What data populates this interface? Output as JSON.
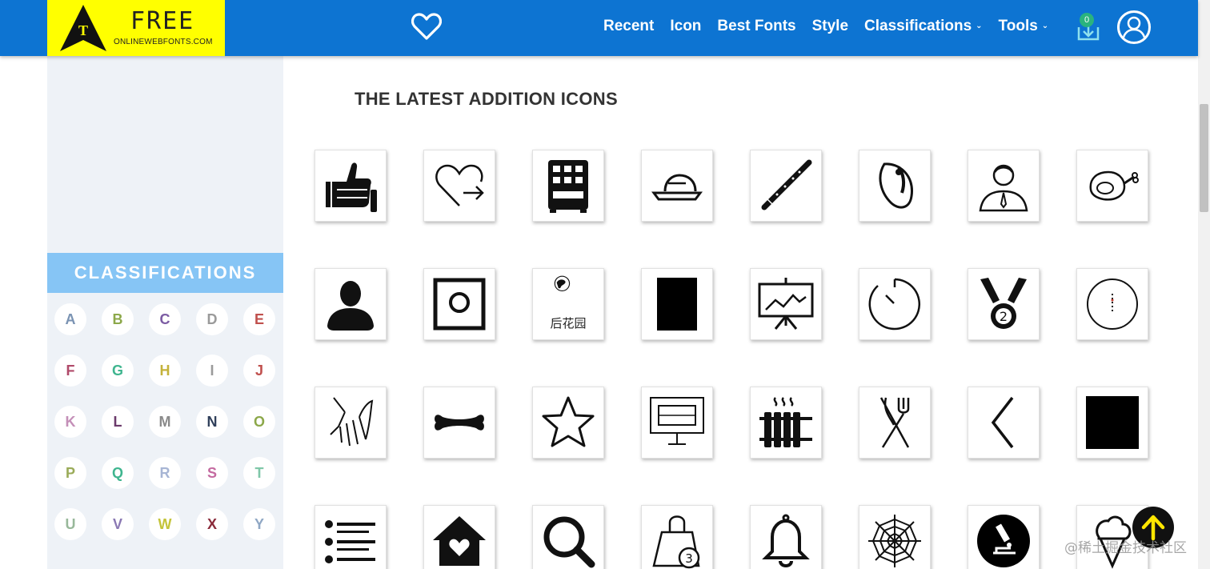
{
  "header": {
    "logo": {
      "free_text": "FREE",
      "site_text": "ONLINEWEBFONTS.COM",
      "mark_letter": "T"
    },
    "favorites_icon": "heart-icon",
    "nav": [
      {
        "label": "Recent",
        "dropdown": false
      },
      {
        "label": "Icon",
        "dropdown": false
      },
      {
        "label": "Best Fonts",
        "dropdown": false
      },
      {
        "label": "Style",
        "dropdown": false
      },
      {
        "label": "Classifications",
        "dropdown": true
      },
      {
        "label": "Tools",
        "dropdown": true
      }
    ],
    "cart": {
      "count": "0",
      "icon": "download-tray-icon"
    },
    "user_icon": "user-avatar-icon"
  },
  "sidebar": {
    "heading": "CLASSIFICATIONS",
    "letters": [
      {
        "label": "A",
        "color": "#7a93b3"
      },
      {
        "label": "B",
        "color": "#8ca84a"
      },
      {
        "label": "C",
        "color": "#7b5ba3"
      },
      {
        "label": "D",
        "color": "#9a9a9a"
      },
      {
        "label": "E",
        "color": "#c0504d"
      },
      {
        "label": "F",
        "color": "#b04a6a"
      },
      {
        "label": "G",
        "color": "#3fb58f"
      },
      {
        "label": "H",
        "color": "#c4b23a"
      },
      {
        "label": "I",
        "color": "#9a9a9a"
      },
      {
        "label": "J",
        "color": "#c0504d"
      },
      {
        "label": "K",
        "color": "#c48fb8"
      },
      {
        "label": "L",
        "color": "#6b3a6b"
      },
      {
        "label": "M",
        "color": "#8a8a8a"
      },
      {
        "label": "N",
        "color": "#2f3f5a"
      },
      {
        "label": "O",
        "color": "#8ca84a"
      },
      {
        "label": "P",
        "color": "#9aab58"
      },
      {
        "label": "Q",
        "color": "#3fb58f"
      },
      {
        "label": "R",
        "color": "#a7b5d4"
      },
      {
        "label": "S",
        "color": "#c46aa0"
      },
      {
        "label": "T",
        "color": "#7fc7a8"
      },
      {
        "label": "U",
        "color": "#98b89a"
      },
      {
        "label": "V",
        "color": "#8a78b3"
      },
      {
        "label": "W",
        "color": "#c4c43a"
      },
      {
        "label": "X",
        "color": "#8a2a3a"
      },
      {
        "label": "Y",
        "color": "#8fa7c4"
      }
    ]
  },
  "main": {
    "title": "THE LATEST ADDITION ICONS",
    "icons": [
      {
        "name": "thumbs-up"
      },
      {
        "name": "heart-arrow"
      },
      {
        "name": "vending-machine"
      },
      {
        "name": "food-cloche"
      },
      {
        "name": "flute"
      },
      {
        "name": "seed"
      },
      {
        "name": "employee"
      },
      {
        "name": "ham"
      },
      {
        "name": "user-silhouette"
      },
      {
        "name": "square-circle"
      },
      {
        "name": "backyard-logo",
        "label": "后花园"
      },
      {
        "name": "black-rectangle"
      },
      {
        "name": "presentation-chart"
      },
      {
        "name": "timer"
      },
      {
        "name": "medal"
      },
      {
        "name": "compass-circle"
      },
      {
        "name": "hand"
      },
      {
        "name": "bone"
      },
      {
        "name": "star"
      },
      {
        "name": "monitor"
      },
      {
        "name": "radiator"
      },
      {
        "name": "fork-knife"
      },
      {
        "name": "chevron-left"
      },
      {
        "name": "black-square"
      },
      {
        "name": "list"
      },
      {
        "name": "home-heart"
      },
      {
        "name": "magnifier"
      },
      {
        "name": "shopping-bag-3",
        "label": "3"
      },
      {
        "name": "bell"
      },
      {
        "name": "spider-web"
      },
      {
        "name": "microscope-circle"
      },
      {
        "name": "ice-cream"
      }
    ]
  },
  "back_to_top_icon": "arrow-up-icon",
  "watermark": "@稀土掘金技术社区",
  "colors": {
    "header": "#0d74d2",
    "logo_bg": "#ffff00",
    "sidebar_bg": "#eef2f7",
    "classifications_bar": "#86c5f5",
    "badge": "#2ab37e",
    "back_to_top_arrow": "#ffe600"
  }
}
